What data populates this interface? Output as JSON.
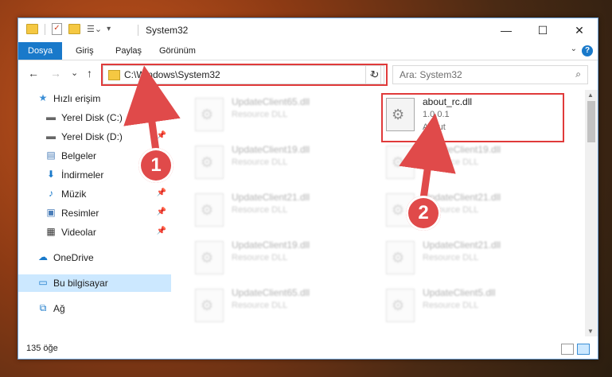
{
  "window": {
    "title": "System32",
    "controls": {
      "minimize": "—",
      "maximize": "☐",
      "close": "✕"
    }
  },
  "ribbon": {
    "tabs": [
      "Dosya",
      "Giriş",
      "Paylaş",
      "Görünüm"
    ],
    "help": "?"
  },
  "nav": {
    "back": "←",
    "forward": "→",
    "recent": "⌄",
    "up": "↑",
    "address": "C:\\Windows\\System32",
    "refresh": "↻",
    "search_placeholder": "Ara: System32"
  },
  "sidebar": {
    "items": [
      {
        "label": "Hızlı erişim",
        "icon": "star-icon"
      },
      {
        "label": "Yerel Disk (C:)",
        "icon": "drive-icon",
        "pinned": true
      },
      {
        "label": "Yerel Disk (D:)",
        "icon": "drive-icon",
        "pinned": true
      },
      {
        "label": "Belgeler",
        "icon": "documents-icon",
        "pinned": true
      },
      {
        "label": "İndirmeler",
        "icon": "download-icon",
        "pinned": true
      },
      {
        "label": "Müzik",
        "icon": "music-icon",
        "pinned": true
      },
      {
        "label": "Resimler",
        "icon": "pictures-icon",
        "pinned": true
      },
      {
        "label": "Videolar",
        "icon": "videos-icon",
        "pinned": true
      },
      {
        "label": "OneDrive",
        "icon": "cloud-icon"
      },
      {
        "label": "Bu bilgisayar",
        "icon": "computer-icon",
        "selected": true
      },
      {
        "label": "Ağ",
        "icon": "network-icon"
      }
    ]
  },
  "files": [
    {
      "name": "UpdateClient65.dll",
      "type": "Resource DLL"
    },
    {
      "name": "about_rc.dll",
      "version": "1.0.0.1",
      "desc": "About"
    },
    {
      "name": "UpdateClient19.dll",
      "type": "Resource DLL"
    },
    {
      "name": "UpdateClient19.dll",
      "type": "Resource DLL"
    },
    {
      "name": "UpdateClient21.dll",
      "type": "Resource DLL"
    },
    {
      "name": "UpdateClient21.dll",
      "type": "Resource DLL"
    },
    {
      "name": "UpdateClient19.dll",
      "type": "Resource DLL"
    },
    {
      "name": "UpdateClient21.dll",
      "type": "Resource DLL"
    },
    {
      "name": "UpdateClient65.dll",
      "type": "Resource DLL"
    },
    {
      "name": "UpdateClient5.dll",
      "type": "Resource DLL"
    }
  ],
  "status": {
    "count": "135 öğe"
  },
  "annotations": {
    "marker1": "1",
    "marker2": "2"
  },
  "colors": {
    "accent": "#1979ca",
    "highlight": "#e03a3a"
  }
}
